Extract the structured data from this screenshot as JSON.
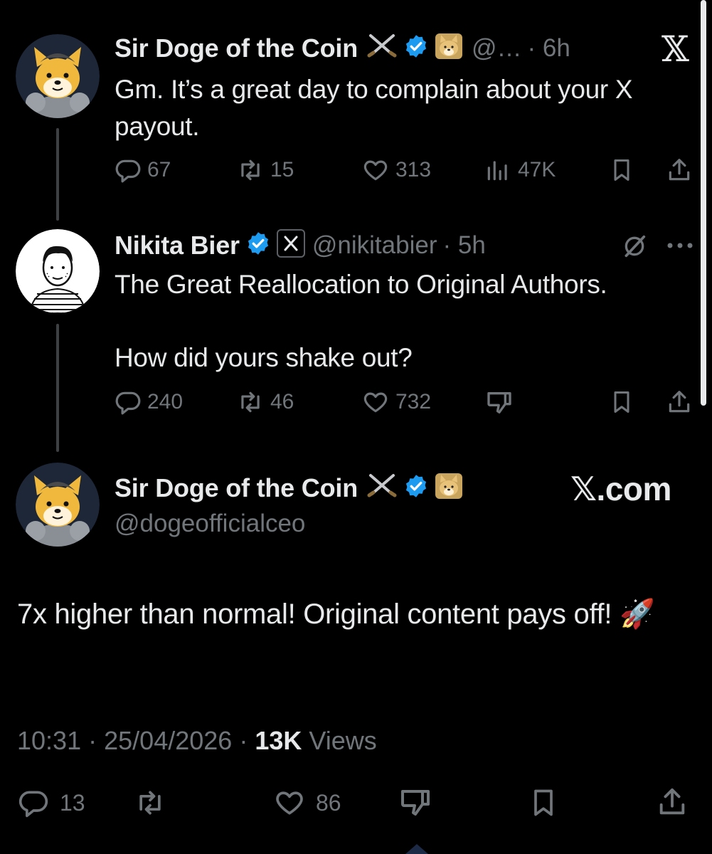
{
  "tweet1": {
    "display_name": "Sir Doge of the Coin",
    "handle": "@…",
    "time": "· 6h",
    "text": "Gm. It’s a great day to complain about your X payout.",
    "replies": "67",
    "reposts": "15",
    "likes": "313",
    "views": "47K"
  },
  "tweet2": {
    "display_name": "Nikita Bier",
    "handle": "@nikitabier",
    "time": "· 5h",
    "text_line1": "The Great Reallocation to Original Authors.",
    "text_line2": "How did yours shake out?",
    "replies": "240",
    "reposts": "46",
    "likes": "732"
  },
  "main_tweet": {
    "display_name": "Sir Doge of the Coin",
    "handle": "@dogeofficialceo",
    "text": "7x higher than normal! Original content pays off! 🚀",
    "time": "10:31",
    "date": "25/04/2026",
    "views_count": "13K",
    "views_label": "Views",
    "replies": "13",
    "likes": "86"
  },
  "watermark": {
    "top_logo": "𝕏",
    "brand": "𝕏.com"
  },
  "colors": {
    "background": "#000000",
    "text": "#e7e9ea",
    "muted": "#71767b",
    "verified": "#1d9bf0",
    "thread_line": "#3e4144"
  },
  "icons": [
    "reply-icon",
    "repost-icon",
    "like-icon",
    "views-icon",
    "bookmark-icon",
    "share-icon",
    "dislike-icon",
    "verified-badge-icon",
    "crossed-swords-icon",
    "doge-emoji-icon",
    "x-affiliate-icon",
    "grok-icon",
    "more-icon",
    "rocket-emoji"
  ]
}
